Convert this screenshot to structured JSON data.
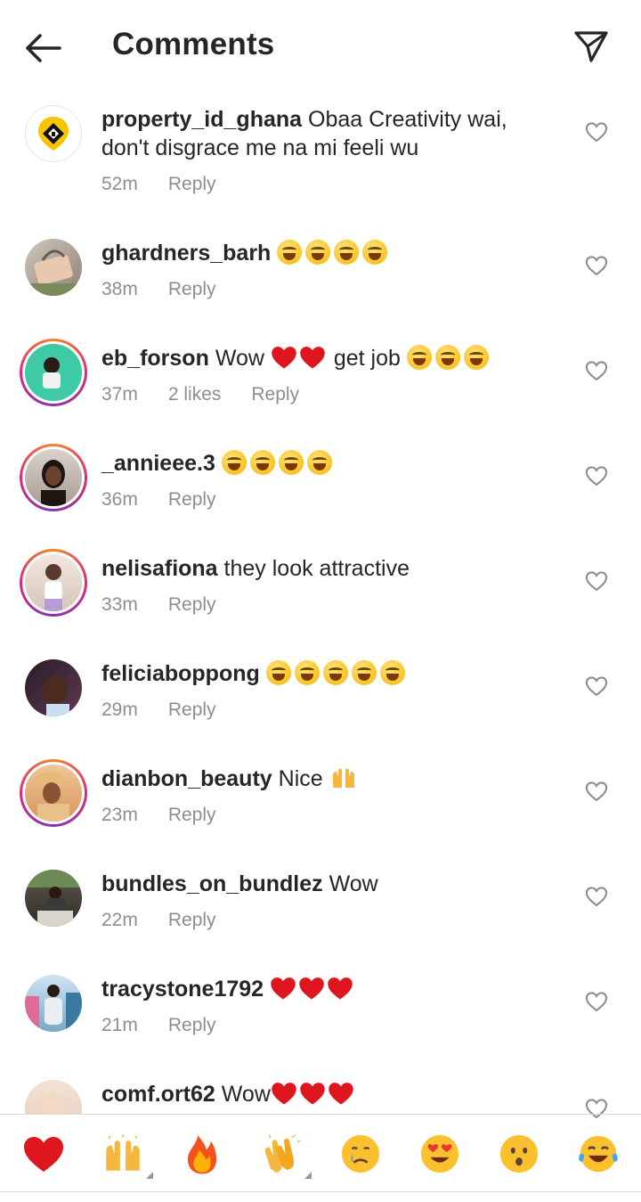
{
  "header": {
    "title": "Comments"
  },
  "comments": [
    {
      "username": "property_id_ghana",
      "text": "Obaa Creativity wai,",
      "text2": "don't disgrace me na mi feeli wu",
      "time": "52m",
      "likes": "",
      "reply": "Reply"
    },
    {
      "username": "ghardners_barh",
      "text": "",
      "time": "38m",
      "likes": "",
      "reply": "Reply"
    },
    {
      "username": "eb_forson",
      "text": "Wow",
      "text_after": "get job",
      "time": "37m",
      "likes": "2 likes",
      "reply": "Reply"
    },
    {
      "username": "_annieee.3",
      "text": "",
      "time": "36m",
      "likes": "",
      "reply": "Reply"
    },
    {
      "username": "nelisafiona",
      "text": "they look attractive",
      "time": "33m",
      "likes": "",
      "reply": "Reply"
    },
    {
      "username": "feliciaboppong",
      "text": "",
      "time": "29m",
      "likes": "",
      "reply": "Reply"
    },
    {
      "username": "dianbon_beauty",
      "text": "Nice",
      "time": "23m",
      "likes": "",
      "reply": "Reply"
    },
    {
      "username": "bundles_on_bundlez",
      "text": "Wow",
      "time": "22m",
      "likes": "",
      "reply": "Reply"
    },
    {
      "username": "tracystone1792",
      "text": "",
      "time": "21m",
      "likes": "",
      "reply": "Reply"
    },
    {
      "username": "comf.ort62",
      "text": "Wow",
      "time": "",
      "likes": "",
      "reply": ""
    }
  ],
  "reactions": [
    "red-heart",
    "raising-hands",
    "fire",
    "clapping-hands",
    "crying-face",
    "heart-eyes",
    "surprised-face",
    "tears-of-joy"
  ],
  "colors": {
    "accent": "#ed4956",
    "meta": "#8e8e8e",
    "text": "#262626"
  }
}
